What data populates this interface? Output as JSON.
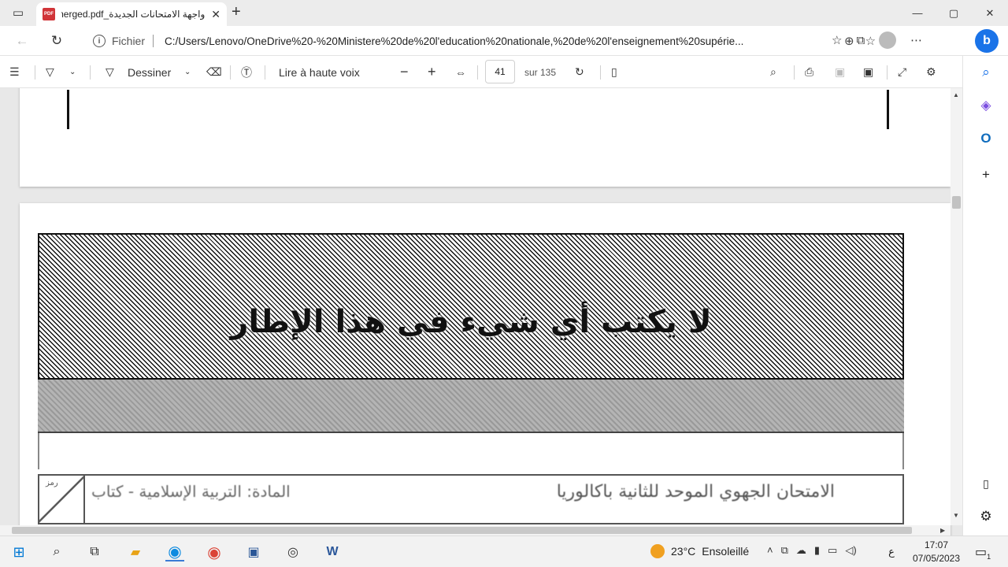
{
  "browser": {
    "tab": {
      "title": "واجهة الامتحانات الجديدة_merged.pdf",
      "close": "✕"
    },
    "new_tab": "+",
    "window_controls": [
      "—",
      "▢",
      "✕"
    ],
    "address": {
      "protocol_label": "Fichier",
      "url": "C:/Users/Lenovo/OneDrive%20-%20Ministere%20de%20l'education%20nationale,%20de%20l'enseignement%20supérie..."
    }
  },
  "pdf_toolbar": {
    "draw_label": "Dessiner",
    "read_aloud_label": "Lire à haute voix",
    "page_current": "41",
    "page_total_label": "sur 135"
  },
  "document": {
    "hatched_box_text": "لا يكتب أي شيء في هذا الإطار",
    "exam_title": "الامتحان الجهوي الموحد للثانية باكالوريا",
    "exam_subject": "المادة: التربية الإسلامية - كتاب",
    "corner_label": "رمز"
  },
  "taskbar": {
    "weather_temp": "23°C",
    "weather_desc": "Ensoleillé",
    "language": "ع",
    "time": "17:07",
    "date": "07/05/2023",
    "notification_count": "1"
  }
}
